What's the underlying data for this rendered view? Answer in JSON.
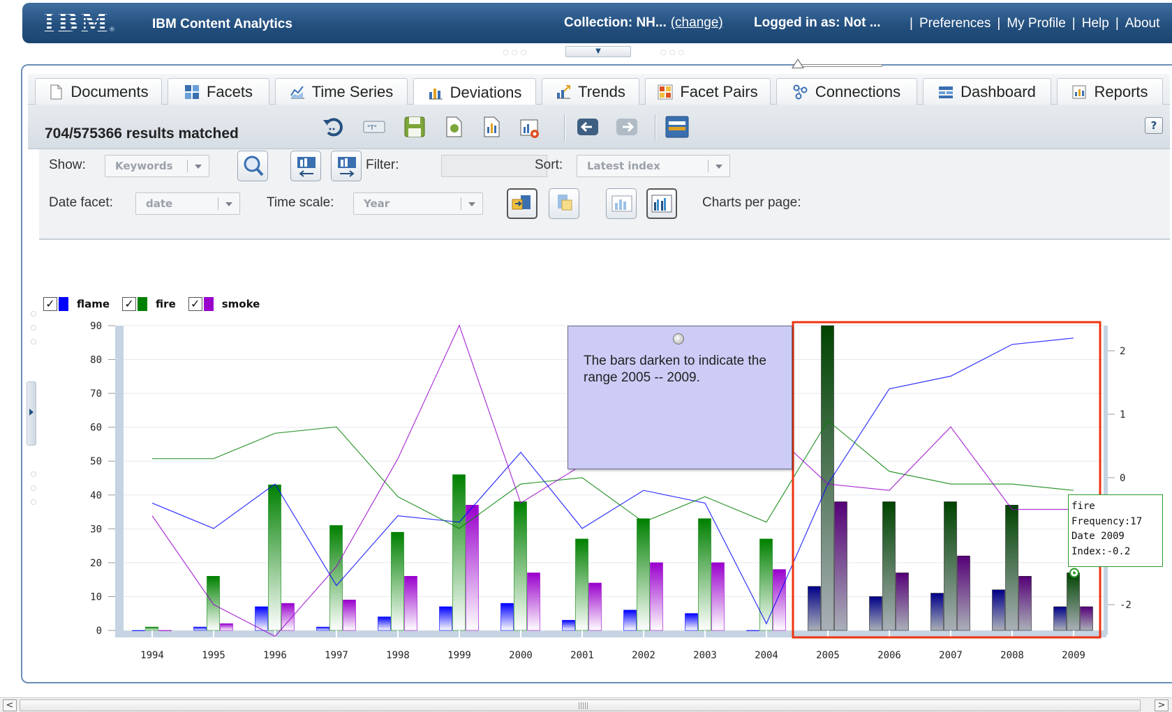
{
  "header": {
    "logo": "IBM",
    "logo_mark": "®",
    "app_title": "IBM Content Analytics",
    "collection_label": "Collection: NH...",
    "change_link": "(change)",
    "logged_in": "Logged in as: Not ...",
    "links": [
      "Preferences",
      "My Profile",
      "Help",
      "About"
    ],
    "link_sep": "|"
  },
  "collapse_arrow": "▼",
  "tabs": [
    {
      "label": "Documents",
      "icon": "document-icon"
    },
    {
      "label": "Facets",
      "icon": "facets-icon"
    },
    {
      "label": "Time Series",
      "icon": "time-series-icon"
    },
    {
      "label": "Deviations",
      "icon": "deviations-icon",
      "active": true
    },
    {
      "label": "Trends",
      "icon": "trends-icon"
    },
    {
      "label": "Facet Pairs",
      "icon": "facet-pairs-icon"
    },
    {
      "label": "Connections",
      "icon": "connections-icon"
    },
    {
      "label": "Dashboard",
      "icon": "dashboard-icon"
    },
    {
      "label": "Reports",
      "icon": "reports-icon"
    }
  ],
  "toolbar": {
    "results": "704/575366 results matched",
    "help": "?"
  },
  "options": {
    "show_label": "Show:",
    "show_value": "Keywords",
    "filter_label": "Filter:",
    "filter_value": "",
    "sort_label": "Sort:",
    "sort_value": "Latest index",
    "date_facet_label": "Date facet:",
    "date_facet_value": "date",
    "time_scale_label": "Time scale:",
    "time_scale_value": "Year",
    "charts_per_page_label": "Charts per page:",
    "charts_per_page_level": 0
  },
  "legend": [
    {
      "name": "flame",
      "color": "#0000ff",
      "checked": true
    },
    {
      "name": "fire",
      "color": "#008000",
      "checked": true
    },
    {
      "name": "smoke",
      "color": "#9900cc",
      "checked": true
    }
  ],
  "note": {
    "text": "The bars darken to indicate the range 2005 -- 2009."
  },
  "tooltip": {
    "lines": [
      "fire",
      "Frequency:17",
      "Date 2009",
      "Index:-0.2"
    ]
  },
  "chart_data": {
    "type": "bar",
    "categories": [
      "1994",
      "1995",
      "1996",
      "1997",
      "1998",
      "1999",
      "2000",
      "2001",
      "2002",
      "2003",
      "2004",
      "2005",
      "2006",
      "2007",
      "2008",
      "2009"
    ],
    "ylim": [
      0,
      90
    ],
    "yticks": [
      0,
      10,
      20,
      30,
      40,
      50,
      60,
      70,
      80,
      90
    ],
    "y2ticks": [
      2,
      1,
      0,
      -2
    ],
    "y2lim": [
      -2.5,
      2.5
    ],
    "highlight_range": [
      "2005",
      "2009"
    ],
    "highlight_color": "#ee3311",
    "series": [
      {
        "name": "flame",
        "color": "#0000ff",
        "values": [
          0,
          1,
          7,
          1,
          4,
          7,
          8,
          3,
          6,
          5,
          0,
          13,
          10,
          11,
          12,
          7
        ],
        "index": [
          -0.4,
          -0.8,
          -0.1,
          -1.7,
          -0.6,
          -0.7,
          0.4,
          -0.8,
          -0.2,
          -0.4,
          -2.3,
          -0.1,
          1.4,
          1.6,
          2.1,
          2.2
        ]
      },
      {
        "name": "fire",
        "color": "#008000",
        "values": [
          1,
          16,
          43,
          31,
          29,
          46,
          38,
          27,
          33,
          33,
          27,
          90,
          38,
          38,
          37,
          17
        ],
        "index": [
          0.3,
          0.3,
          0.7,
          0.8,
          -0.3,
          -0.8,
          -0.1,
          0.0,
          -0.7,
          -0.3,
          -0.7,
          0.9,
          0.1,
          -0.1,
          -0.1,
          -0.2
        ]
      },
      {
        "name": "smoke",
        "color": "#9900cc",
        "values": [
          0,
          2,
          8,
          9,
          16,
          37,
          17,
          14,
          20,
          20,
          18,
          38,
          17,
          22,
          16,
          7
        ],
        "index": [
          -0.6,
          -2.0,
          -2.5,
          -1.4,
          0.3,
          2.4,
          -0.4,
          0.2,
          0.5,
          0.5,
          0.8,
          -0.1,
          -0.2,
          0.8,
          -0.5,
          -0.5
        ]
      }
    ]
  },
  "scrollbar": {
    "left": "<",
    "right": ">"
  }
}
